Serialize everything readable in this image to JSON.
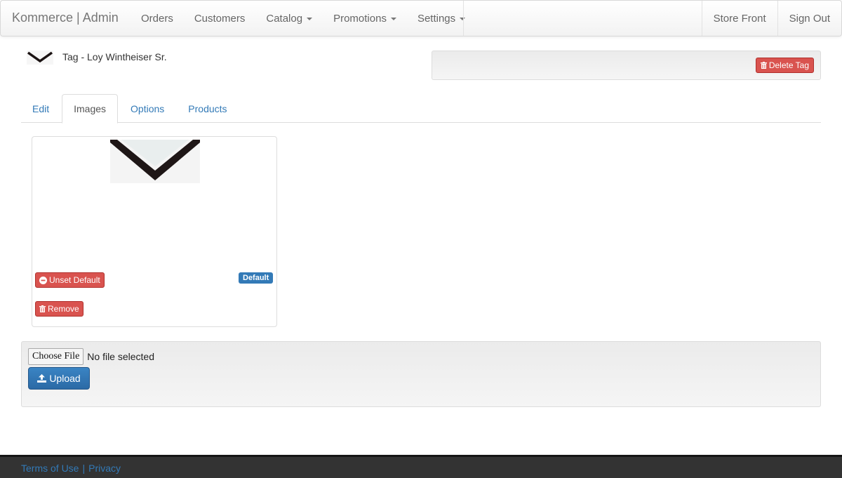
{
  "navbar": {
    "brand": "Kommerce | Admin",
    "left_items": [
      {
        "label": "Orders"
      },
      {
        "label": "Customers"
      },
      {
        "label": "Catalog"
      },
      {
        "label": "Promotions"
      },
      {
        "label": "Settings"
      }
    ],
    "right_items": [
      {
        "label": "Store Front"
      },
      {
        "label": "Sign Out"
      }
    ]
  },
  "page": {
    "title": "Tag - Loy Wintheiser Sr.",
    "delete_label": "Delete Tag"
  },
  "tabs": [
    {
      "label": "Edit",
      "active": false
    },
    {
      "label": "Images",
      "active": true
    },
    {
      "label": "Options",
      "active": false
    },
    {
      "label": "Products",
      "active": false
    }
  ],
  "image_card": {
    "unset_default_label": "Unset Default",
    "default_badge": "Default",
    "remove_label": "Remove"
  },
  "upload": {
    "choose_file_label": "Choose File",
    "no_file_text": "No file selected",
    "upload_label": "Upload"
  },
  "footer": {
    "terms": "Terms of Use",
    "separator": "|",
    "privacy": "Privacy"
  },
  "colors": {
    "danger": "#d9534f",
    "primary": "#337ab7",
    "footer_bg": "#333333"
  },
  "icons": {
    "trash": "trash-icon",
    "minus_circle": "minus-circle-icon",
    "upload": "upload-icon",
    "caret": "caret-down-icon"
  }
}
